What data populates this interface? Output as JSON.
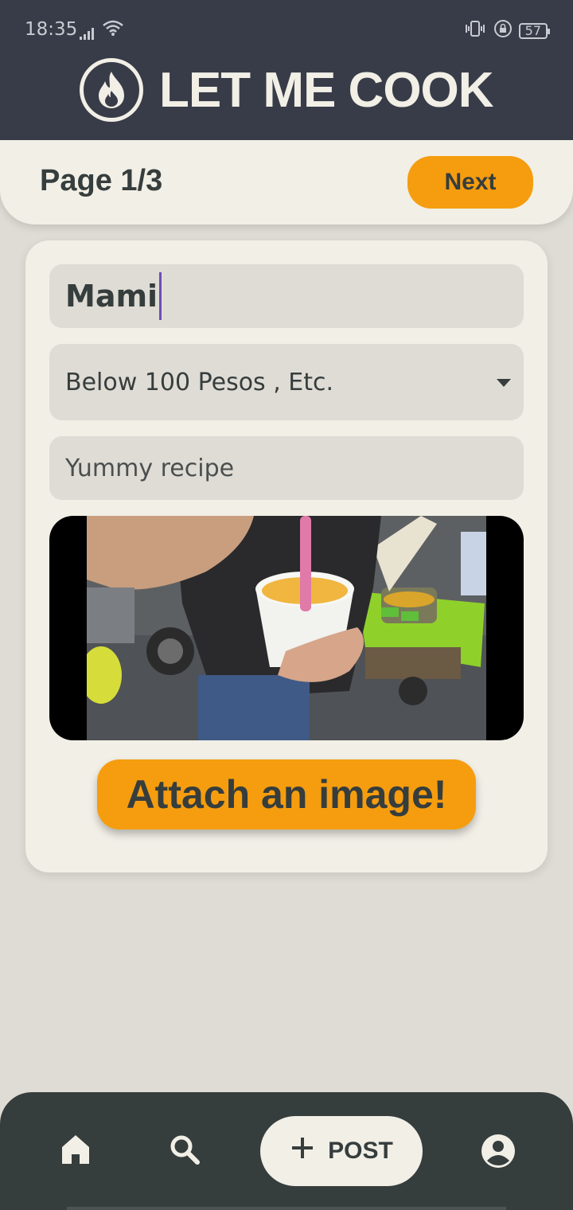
{
  "status_bar": {
    "time": "18:35",
    "battery": "57"
  },
  "header": {
    "app_title": "LET ME COOK"
  },
  "page_bar": {
    "page_label": "Page 1/3",
    "next_label": "Next"
  },
  "form": {
    "recipe_name": "Mami",
    "price_value": "Below 100 Pesos  , Etc.",
    "description_value": "Yummy recipe",
    "attach_label": "Attach an image!"
  },
  "bottom_nav": {
    "post_label": "POST"
  },
  "colors": {
    "header_bg": "#383c48",
    "accent": "#f59d0f",
    "card_bg": "#f1efe6",
    "page_bg": "#dfdcd5",
    "nav_bg": "#363d3d"
  }
}
